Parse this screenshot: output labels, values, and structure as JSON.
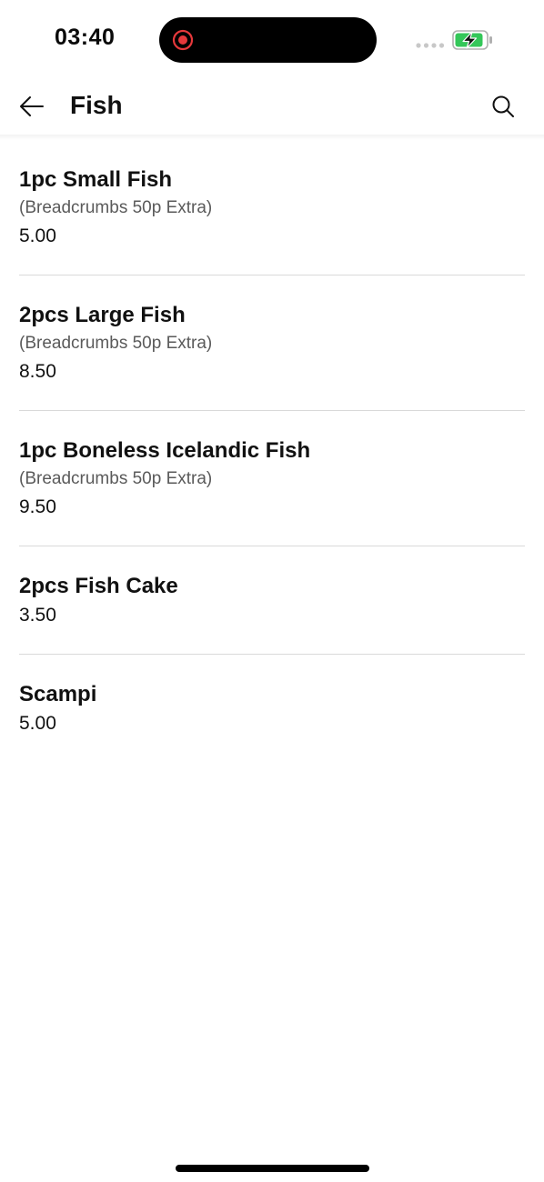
{
  "status_bar": {
    "time": "03:40",
    "icons": [
      "screen-recording-icon",
      "signal-icon",
      "battery-charging-icon"
    ],
    "recording_color": "#e5383b",
    "battery_color": "#34c759"
  },
  "header": {
    "title": "Fish",
    "back_icon": "arrow-left-icon",
    "search_icon": "search-icon"
  },
  "menu": {
    "items": [
      {
        "name": "1pc Small Fish",
        "note": "(Breadcrumbs 50p Extra)",
        "price": "5.00"
      },
      {
        "name": "2pcs Large Fish",
        "note": "(Breadcrumbs 50p Extra)",
        "price": "8.50"
      },
      {
        "name": "1pc Boneless Icelandic Fish",
        "note": "(Breadcrumbs 50p Extra)",
        "price": "9.50"
      },
      {
        "name": "2pcs Fish Cake",
        "price": "3.50"
      },
      {
        "name": "Scampi",
        "price": "5.00"
      }
    ]
  }
}
